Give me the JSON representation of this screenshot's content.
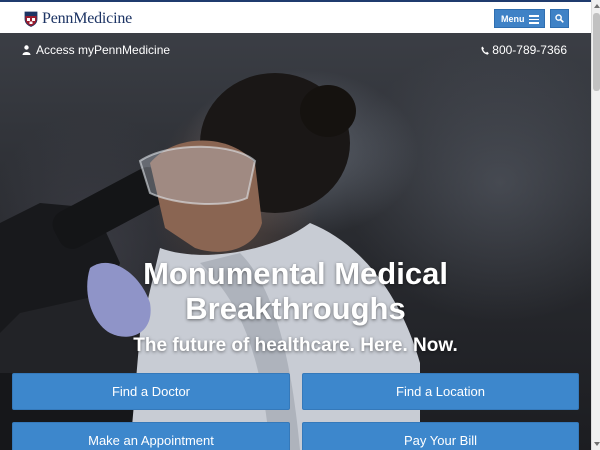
{
  "header": {
    "logo_text": "PennMedicine",
    "menu_label": "Menu",
    "brand_color": "#1d3464",
    "button_color": "#3f82c6",
    "icons": {
      "logo": "penn-shield-icon",
      "menu": "hamburger-icon",
      "search": "search-icon"
    }
  },
  "hero": {
    "access_label": "Access myPennMedicine",
    "phone": "800-789-7366",
    "headline_line1": "Monumental Medical",
    "headline_line2": "Breakthroughs",
    "subhead": "The future of healthcare. Here. Now.",
    "icons": {
      "access": "person-icon",
      "phone": "phone-icon"
    }
  },
  "quick_links": [
    {
      "label": "Find a Doctor"
    },
    {
      "label": "Find a Location"
    },
    {
      "label": "Make an Appointment"
    },
    {
      "label": "Pay Your Bill"
    }
  ],
  "accent_color": "#3d87cc"
}
